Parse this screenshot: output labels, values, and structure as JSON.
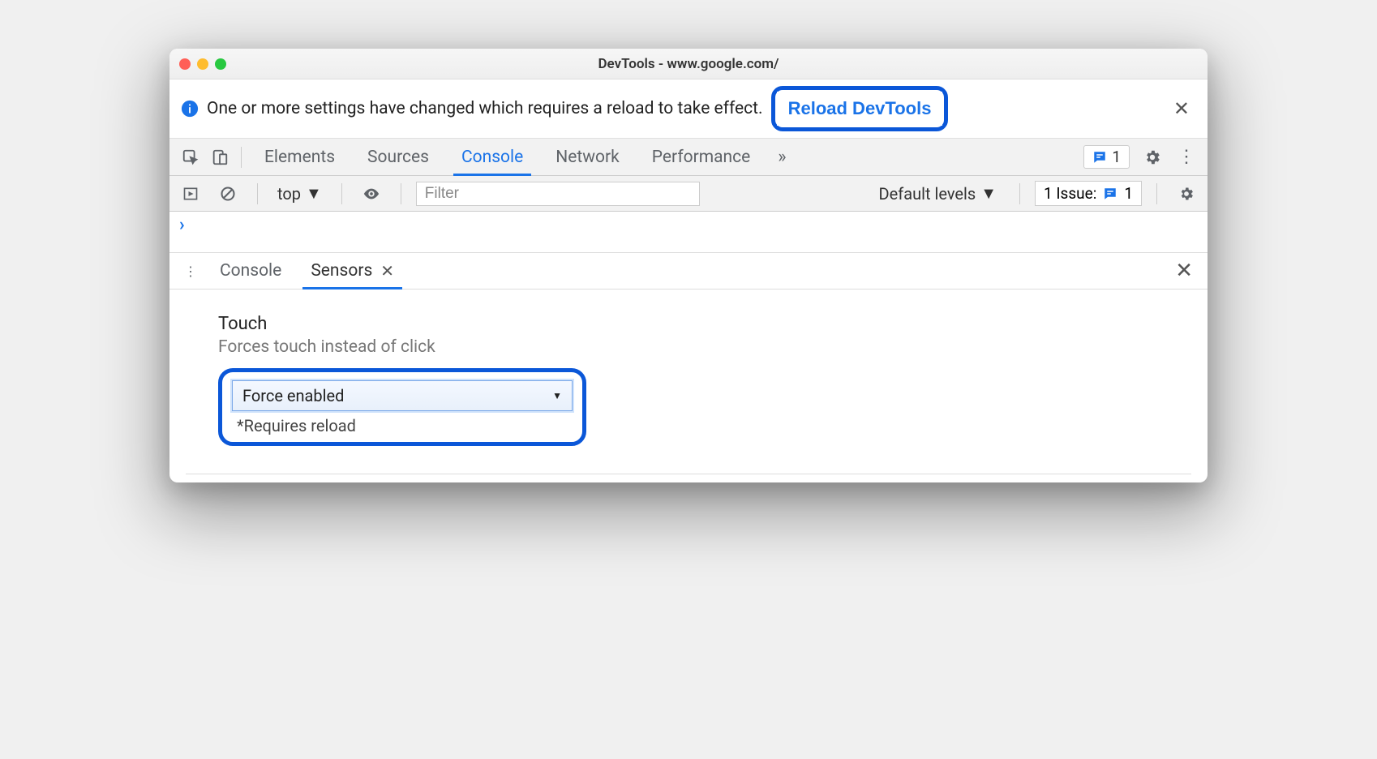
{
  "window": {
    "title": "DevTools - www.google.com/"
  },
  "infobar": {
    "message": "One or more settings have changed which requires a reload to take effect.",
    "reload_label": "Reload DevTools"
  },
  "tabs": {
    "items": [
      "Elements",
      "Sources",
      "Console",
      "Network",
      "Performance"
    ],
    "active_index": 2,
    "issue_count": "1"
  },
  "console_toolbar": {
    "context": "top",
    "filter_placeholder": "Filter",
    "levels": "Default levels",
    "issues_label": "1 Issue:",
    "issues_count": "1"
  },
  "drawer": {
    "tabs": [
      "Console",
      "Sensors"
    ],
    "active_index": 1
  },
  "sensor": {
    "title": "Touch",
    "subtitle": "Forces touch instead of click",
    "select_value": "Force enabled",
    "note": "*Requires reload"
  }
}
